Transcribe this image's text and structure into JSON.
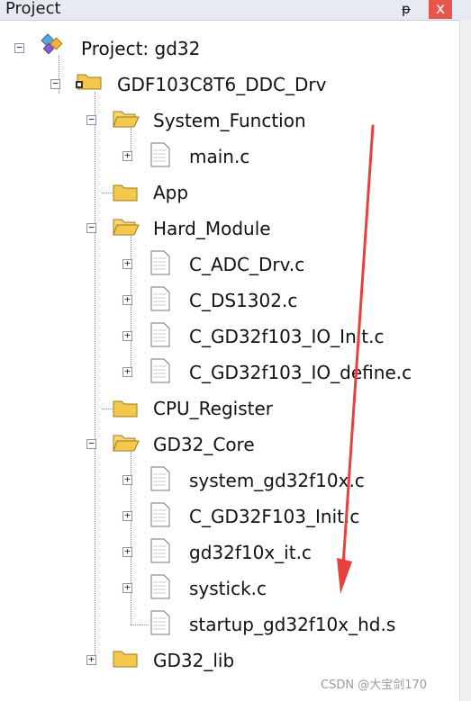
{
  "panel": {
    "title": "Project",
    "pin_glyph": "ᵽ",
    "close_glyph": "x"
  },
  "tree": {
    "project_label": "Project: gd32",
    "target_label": "GDF103C8T6_DDC_Drv",
    "groups": [
      {
        "label": "System_Function",
        "expanded": true,
        "files": [
          "main.c"
        ]
      },
      {
        "label": "App",
        "expanded": false,
        "files": []
      },
      {
        "label": "Hard_Module",
        "expanded": true,
        "files": [
          "C_ADC_Drv.c",
          "C_DS1302.c",
          "C_GD32f103_IO_Init.c",
          "C_GD32f103_IO_define.c"
        ]
      },
      {
        "label": "CPU_Register",
        "expanded": false,
        "files": []
      },
      {
        "label": "GD32_Core",
        "expanded": true,
        "files": [
          "system_gd32f10x.c",
          "C_GD32F103_Init.c",
          "gd32f10x_it.c",
          "systick.c",
          "startup_gd32f10x_hd.s"
        ]
      },
      {
        "label": "GD32_lib",
        "expanded": false,
        "files": []
      }
    ]
  },
  "icons": {
    "project": "project-diamond-icon",
    "target": "folder-target-icon",
    "folder_open": "folder-open-icon",
    "folder_closed": "folder-icon",
    "file": "file-icon"
  },
  "colors": {
    "folder": "#f2c94c",
    "annotation_arrow": "#e8403c"
  },
  "watermark": "CSDN @大宝剑170"
}
